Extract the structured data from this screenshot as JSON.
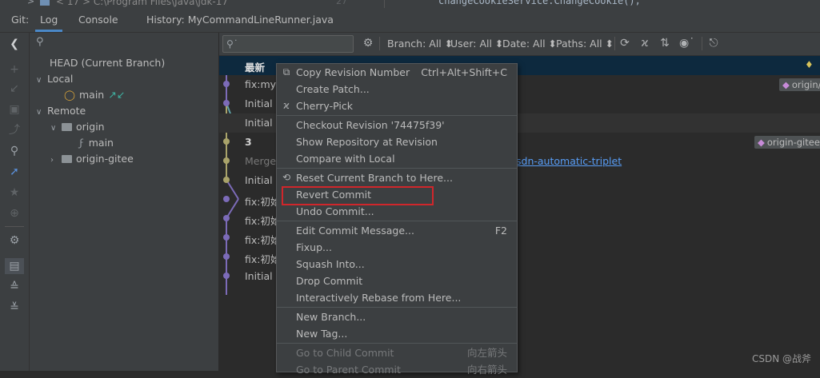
{
  "background_strip": {
    "tree_prefix": "> ",
    "jdk_label": "< 17 >",
    "jdk_path": "C:\\Program Files\\Java\\jdk-17",
    "line_number": "27",
    "code_text": "changeCookieService.ChangeCookie();"
  },
  "tabs": {
    "git_label": "Git:",
    "items": [
      "Log",
      "Console",
      "History: MyCommandLineRunner.java"
    ]
  },
  "tree": {
    "head": "HEAD (Current Branch)",
    "local": "Local",
    "main_local": "main",
    "remote": "Remote",
    "origin": "origin",
    "main_remote": "main",
    "origin_gitee": "origin-gitee"
  },
  "toolbar": {
    "search_placeholder": "",
    "filters": [
      "Branch: All",
      "User: All",
      "Date: All",
      "Paths: All"
    ]
  },
  "commits": [
    {
      "msg": "最新"
    },
    {
      "msg": "fix:mys"
    },
    {
      "msg": "Initial c"
    },
    {
      "msg": "Initial c"
    },
    {
      "msg": "3"
    },
    {
      "msg": "Merge"
    },
    {
      "msg": "Initial c"
    },
    {
      "msg": "fix:初始"
    },
    {
      "msg": "fix:初始"
    },
    {
      "msg": "fix:初始"
    },
    {
      "msg": "fix:初始"
    },
    {
      "msg": "Initial c"
    }
  ],
  "tags": {
    "origin_main": "origin/",
    "origin_gitee_main": "origin-gitee/"
  },
  "link_text": "sdn-automatic-triplet",
  "context_menu": {
    "copy_revision": "Copy Revision Number",
    "copy_shortcut": "Ctrl+Alt+Shift+C",
    "create_patch": "Create Patch...",
    "cherry_pick": "Cherry-Pick",
    "checkout_revision": "Checkout Revision '74475f39'",
    "show_repo": "Show Repository at Revision",
    "compare_local": "Compare with Local",
    "reset_branch": "Reset Current Branch to Here...",
    "revert_commit": "Revert Commit",
    "undo_commit": "Undo Commit...",
    "edit_message": "Edit Commit Message...",
    "edit_shortcut": "F2",
    "fixup": "Fixup...",
    "squash": "Squash Into...",
    "drop": "Drop Commit",
    "rebase": "Interactively Rebase from Here...",
    "new_branch": "New Branch...",
    "new_tag": "New Tag...",
    "go_child": "Go to Child Commit",
    "go_child_shortcut": "向左箭头",
    "go_parent": "Go to Parent Commit",
    "go_parent_shortcut": "向右箭头"
  },
  "watermark": "CSDN @战斧",
  "colors": {
    "accent": "#4a88c7",
    "highlight": "#d0262b",
    "graph_purple": "#7c6bb8",
    "graph_olive": "#a9a36a",
    "graph_teal": "#5fa3a8"
  }
}
